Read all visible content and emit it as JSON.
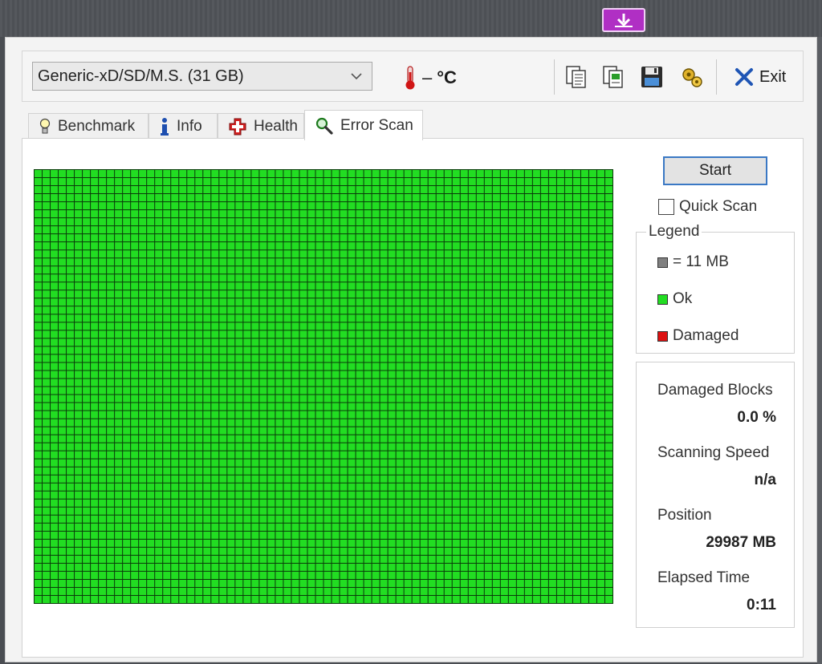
{
  "drive": {
    "selected": "Generic-xD/SD/M.S. (31 GB)"
  },
  "temperature": {
    "value": "–",
    "unit": "°C"
  },
  "toolbar": {
    "exit_label": "Exit"
  },
  "tabs": [
    {
      "label": "Benchmark",
      "icon": "lightbulb-icon"
    },
    {
      "label": "Info",
      "icon": "info-icon"
    },
    {
      "label": "Health",
      "icon": "health-cross-icon"
    },
    {
      "label": "Error Scan",
      "icon": "magnifier-icon",
      "active": true
    }
  ],
  "scan": {
    "start_label": "Start",
    "quick_scan_label": "Quick Scan",
    "quick_scan_checked": false
  },
  "legend": {
    "title": "Legend",
    "block_size": "= 11 MB",
    "ok": "Ok",
    "damaged": "Damaged"
  },
  "stats": {
    "damaged_blocks_label": "Damaged Blocks",
    "damaged_blocks_value": "0.0 %",
    "scanning_speed_label": "Scanning Speed",
    "scanning_speed_value": "n/a",
    "position_label": "Position",
    "position_value": "29987 MB",
    "elapsed_time_label": "Elapsed Time",
    "elapsed_time_value": "0:11"
  },
  "colors": {
    "ok": "#22dd22",
    "damaged": "#dd1111",
    "unscanned": "#808080",
    "accent": "#3a78c4",
    "badge": "#b02fc4"
  },
  "block_map": {
    "columns": 72,
    "rows": 54,
    "state": "ok"
  }
}
